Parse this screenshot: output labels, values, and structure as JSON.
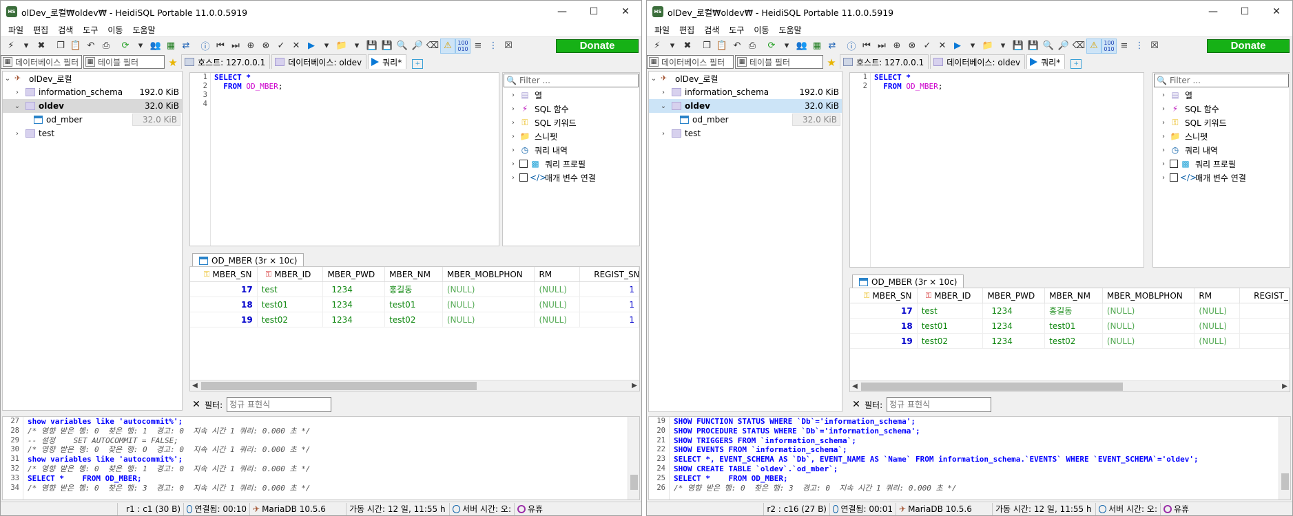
{
  "colors": {
    "accent": "#0a79d6",
    "donate": "#16b116",
    "keyword": "#0000ff",
    "identifier": "#cc00cc"
  },
  "windows": [
    {
      "title": "olDev_로컬₩oldev₩ - HeidiSQL Portable 11.0.0.5919",
      "menu": [
        "파일",
        "편집",
        "검색",
        "도구",
        "이동",
        "도움말"
      ],
      "donate": "Donate",
      "db_filter": "데이터베이스 필터",
      "table_filter": "테이블 필터",
      "tabs": {
        "host": "호스트: 127.0.0.1",
        "database": "데이터베이스: oldev",
        "query": "쿼리*"
      },
      "tree": {
        "root": "olDev_로컬",
        "items": [
          {
            "name": "information_schema",
            "size": "192.0 KiB"
          },
          {
            "name": "oldev",
            "size": "32.0 KiB"
          },
          {
            "name": "od_mber",
            "size": "32.0 KiB"
          },
          {
            "name": "test",
            "size": ""
          }
        ]
      },
      "editor": {
        "line_numbers": [
          "1",
          "2",
          "3",
          "4"
        ],
        "lines": [
          [
            "SELECT *"
          ],
          [
            "  FROM ",
            "OD_MBER",
            ";"
          ],
          [
            ""
          ],
          [
            ""
          ]
        ]
      },
      "helper": {
        "filter_placeholder": "Filter ...",
        "items": [
          "열",
          "SQL 함수",
          "SQL 키워드",
          "스니펫",
          "쿼리 내역",
          "쿼리 프로필",
          "매개 변수 연결"
        ]
      },
      "result_tab": "OD_MBER (3r × 10c)",
      "columns": [
        "MBER_SN",
        "MBER_ID",
        "MBER_PWD",
        "MBER_NM",
        "MBER_MOBLPHON",
        "RM",
        "REGIST_SN"
      ],
      "rows": [
        [
          "17",
          "test",
          "1234",
          "홍길동",
          "(NULL)",
          "(NULL)",
          "1"
        ],
        [
          "18",
          "test01",
          "1234",
          "test01",
          "(NULL)",
          "(NULL)",
          "1"
        ],
        [
          "19",
          "test02",
          "1234",
          "test02",
          "(NULL)",
          "(NULL)",
          "1"
        ]
      ],
      "filter_label": "필터:",
      "filter_placeholder": "정규 표현식",
      "log": {
        "line_numbers": [
          "27",
          "28",
          "29",
          "30",
          "31",
          "32",
          "33",
          "34"
        ],
        "lines": [
          "show variables like 'autocommit%';",
          "/* 영향 받은 행: 0  찾은 행: 1  경고: 0  지속 시간 1 쿼리: 0.000 초 */",
          "-- 설정    SET AUTOCOMMIT = FALSE;",
          "/* 영향 받은 행: 0  찾은 행: 0  경고: 0  지속 시간 1 쿼리: 0.000 초 */",
          "show variables like 'autocommit%';",
          "/* 영향 받은 행: 0  찾은 행: 1  경고: 0  지속 시간 1 쿼리: 0.000 초 */",
          "SELECT *    FROM OD_MBER;",
          "/* 영향 받은 행: 0  찾은 행: 3  경고: 0  지속 시간 1 쿼리: 0.000 초 */"
        ]
      },
      "status": {
        "pos": "r1 : c1 (30 B)",
        "connected": "연결됨: 00:10",
        "server": "MariaDB 10.5.6",
        "uptime": "가동 시간: 12 일, 11:55 h",
        "server_time": "서버 시간: 오:",
        "idle": "유휴"
      }
    },
    {
      "title": "olDev_로컬₩oldev₩ - HeidiSQL Portable 11.0.0.5919",
      "menu": [
        "파일",
        "편집",
        "검색",
        "도구",
        "이동",
        "도움말"
      ],
      "donate": "Donate",
      "db_filter": "데이터베이스 필터",
      "table_filter": "테이블 필터",
      "tabs": {
        "host": "호스트: 127.0.0.1",
        "database": "데이터베이스: oldev",
        "query": "쿼리*"
      },
      "tree": {
        "root": "olDev_로컬",
        "items": [
          {
            "name": "information_schema",
            "size": "192.0 KiB"
          },
          {
            "name": "oldev",
            "size": "32.0 KiB"
          },
          {
            "name": "od_mber",
            "size": "32.0 KiB"
          },
          {
            "name": "test",
            "size": ""
          }
        ]
      },
      "editor": {
        "line_numbers": [
          "1",
          "2"
        ],
        "lines": [
          [
            "SELECT *"
          ],
          [
            "  FROM ",
            "OD_MBER",
            ";"
          ]
        ]
      },
      "helper": {
        "filter_placeholder": "Filter ...",
        "items": [
          "열",
          "SQL 함수",
          "SQL 키워드",
          "스니펫",
          "쿼리 내역",
          "쿼리 프로필",
          "매개 변수 연결"
        ]
      },
      "result_tab": "OD_MBER (3r × 10c)",
      "columns": [
        "MBER_SN",
        "MBER_ID",
        "MBER_PWD",
        "MBER_NM",
        "MBER_MOBLPHON",
        "RM",
        "REGIST_"
      ],
      "rows": [
        [
          "17",
          "test",
          "1234",
          "홍길동",
          "(NULL)",
          "(NULL)",
          ""
        ],
        [
          "18",
          "test01",
          "1234",
          "test01",
          "(NULL)",
          "(NULL)",
          ""
        ],
        [
          "19",
          "test02",
          "1234",
          "test02",
          "(NULL)",
          "(NULL)",
          ""
        ]
      ],
      "filter_label": "필터:",
      "filter_placeholder": "정규 표현식",
      "log": {
        "line_numbers": [
          "19",
          "20",
          "21",
          "22",
          "23",
          "24",
          "25",
          "26"
        ],
        "lines": [
          "SHOW FUNCTION STATUS WHERE `Db`='information_schema';",
          "SHOW PROCEDURE STATUS WHERE `Db`='information_schema';",
          "SHOW TRIGGERS FROM `information_schema`;",
          "SHOW EVENTS FROM `information_schema`;",
          "SELECT *, EVENT_SCHEMA AS `Db`, EVENT_NAME AS `Name` FROM information_schema.`EVENTS` WHERE `EVENT_SCHEMA`='oldev';",
          "SHOW CREATE TABLE `oldev`.`od_mber`;",
          "SELECT *    FROM OD_MBER;",
          "/* 영향 받은 행: 0  찾은 행: 3  경고: 0  지속 시간 1 쿼리: 0.000 초 */"
        ]
      },
      "status": {
        "pos": "r2 : c16 (27 B)",
        "connected": "연결됨: 00:01",
        "server": "MariaDB 10.5.6",
        "uptime": "가동 시간: 12 일, 11:55 h",
        "server_time": "서버 시간: 오:",
        "idle": "유휴"
      }
    }
  ]
}
